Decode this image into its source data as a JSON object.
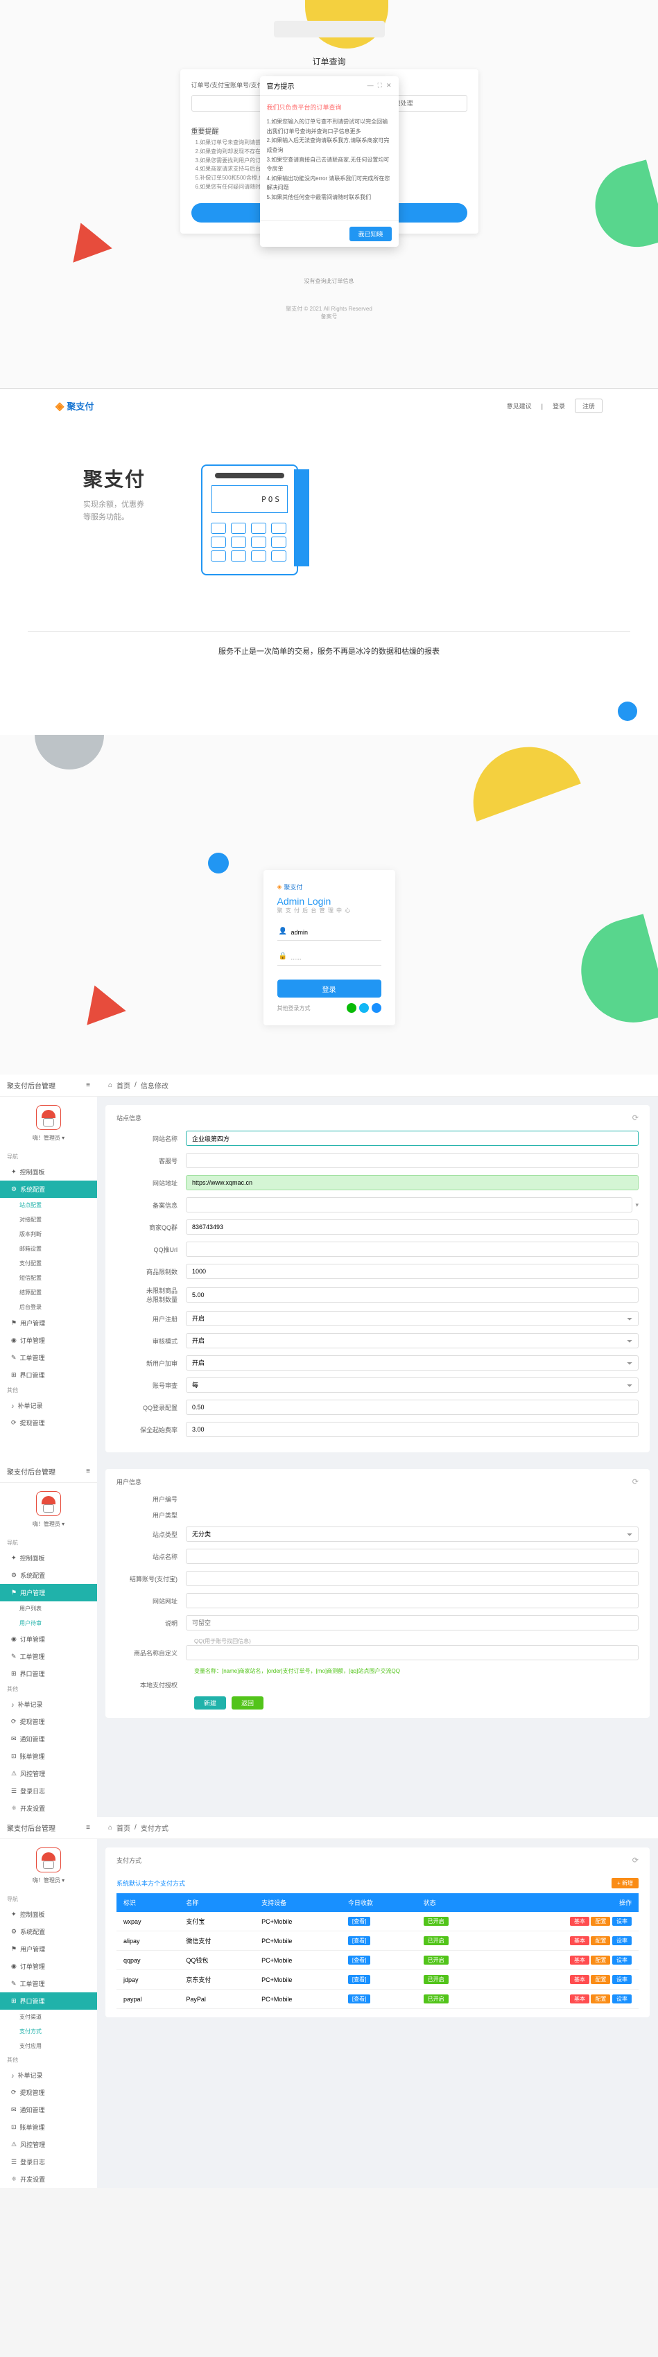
{
  "s1": {
    "title": "订单查询",
    "card_label": "订单号/支付宝账单号/支付宝uid/支付宝uid/总金额",
    "card_input_right": "请输入订单号进行问题处理",
    "tips_title": "重要提醒",
    "tips": [
      "1.如果订单号未查询到请尝试输入支付宝账单号或者uid查询",
      "2.如果查询到却发现不存在则可能是您输入的订单号格式有误",
      "3.如果您需要找到用户的订单,请联系商家并完成的账单",
      "4.如果商家请求支持与后台账号或后台账号和付款账号直接联系",
      "5.补偿订单500和500含橙,但不能完全退款规避未知账号",
      "6.如果您有任何疑问请随时联系客服"
    ],
    "submit": "查询",
    "modal_title": "官方提示",
    "modal_body_title": "我们只负责平台的订单查询",
    "modal_body": [
      "1.如果您输入的订单号查不到请尝试可以完全回输出我们订单号查询并查询口子信息更多",
      "2.如果输入后无法查询请联系我方,请联系商家可完成查询",
      "3.如果空查请直接自己去请联商家,无任何设置均可令房单",
      "4.如果输出功能没内error 请联系我们可完成所在您解决问题",
      "5.如果其他任何查中最需间请随时联系我们"
    ],
    "modal_btn": "我已知晓",
    "bottom_text": "没有查询此订单信息",
    "footer1": "聚支付 © 2021 All Rights Reserved",
    "footer2": "备案号"
  },
  "s2": {
    "logo": "聚支付",
    "header_links": [
      "意见建议",
      "登录"
    ],
    "header_btn": "注册",
    "hero_title": "聚支付",
    "hero_sub": "实现余额，优惠券\n等服务功能。",
    "pos_text": "POS",
    "tagline": "服务不止是一次简单的交易，服务不再是冰冷的数据和枯燥的报表"
  },
  "s3": {
    "logo": "聚支付",
    "title": "Admin Login",
    "subtitle": "聚 支 付 后 台 管 理 中 心",
    "user_value": "admin",
    "pass_placeholder": "......",
    "btn": "登录",
    "footer_label": "其他登录方式"
  },
  "admin_common": {
    "brand": "聚支付后台管理",
    "avatar_name": "嗨！管理员 ▾",
    "section1": "导航",
    "section2": "其他",
    "menus": {
      "dashboard": "控制面板",
      "system": "系统配置",
      "system_subs": [
        "站点配置",
        "对接配置",
        "版本判断",
        "邮箱设置",
        "支付配置",
        "短信配置",
        "结算配置",
        "后台登录"
      ],
      "user": "用户管理",
      "user_subs": [
        "用户列表",
        "用户待审"
      ],
      "order": "订单管理",
      "work": "工单管理",
      "ui": "界口管理",
      "ui_subs": [
        "支付渠道",
        "支付方式",
        "支付应用"
      ],
      "pay": "补单记录",
      "cash": "提现管理",
      "notice": "通知管理",
      "bill": "账单管理",
      "risk": "风控管理",
      "log": "登录日志",
      "develop": "开发设置"
    }
  },
  "s4": {
    "breadcrumb_home": "首页",
    "breadcrumb_page": "信息修改",
    "panel_title": "站点信息",
    "fields": {
      "site_name": {
        "label": "网站名称",
        "value": "企业级第四方"
      },
      "customer": {
        "label": "客服号",
        "value": ""
      },
      "site_url": {
        "label": "网站地址",
        "value": "https://www.xqmac.cn"
      },
      "record": {
        "label": "备案信息",
        "value": ""
      },
      "qq_group": {
        "label": "商家QQ群",
        "value": "836743493"
      },
      "qq_key": {
        "label": "QQ推Url",
        "value": ""
      },
      "product_limit": {
        "label": "商品限制数",
        "value": "1000"
      },
      "unpaid_limit": {
        "label": "未限制商品\n总限制数量",
        "value": "5.00"
      },
      "user_reg": {
        "label": "用户注册",
        "value": "开启"
      },
      "approval": {
        "label": "审核模式",
        "value": "开启"
      },
      "product_review": {
        "label": "新用户加审",
        "value": "开启"
      },
      "acc_review": {
        "label": "账号审查",
        "value": "每"
      },
      "qq_login": {
        "label": "QQ登录配置",
        "value": "0.50"
      },
      "daily_fee": {
        "label": "保全起始费率",
        "value": "3.00"
      }
    }
  },
  "s5": {
    "panel_title": "用户信息",
    "fields": {
      "uid": {
        "label": "用户编号",
        "value": ""
      },
      "utype": {
        "label": "用户类型",
        "value": ""
      },
      "site_type": {
        "label": "站点类型",
        "value": "无分类"
      },
      "site_name": {
        "label": "站点名称",
        "value": ""
      },
      "site_title": {
        "label": "结算账号(支付宝)",
        "value": ""
      },
      "site_url": {
        "label": "网站网址",
        "value": ""
      },
      "desc": {
        "label": "说明",
        "value": "可留空"
      },
      "qq": {
        "label": ""
      },
      "intro": {
        "label": "商品名称自定义"
      }
    },
    "help_note": "变量名称：[name]商家站名，[order]支付订单号，[mo]商测额，[qq]站点围户交流QQ",
    "local_pay": "本地支付授权",
    "btn_new": "新建",
    "btn_edit": "返回"
  },
  "s6": {
    "breadcrumb_page": "支付方式",
    "panel_title": "支付方式",
    "table_note": "系统默认本方个支付方式",
    "add_btn": "+ 新增",
    "columns": [
      "标识",
      "名称",
      "支持设备",
      "今日收款",
      "状态",
      "操作"
    ],
    "rows": [
      {
        "id": "wxpay",
        "name": "支付宝",
        "device": "PC+Mobile",
        "amount": "[查看]",
        "status": "已开启",
        "actions": [
          "基本",
          "配置",
          "设率"
        ]
      },
      {
        "id": "alipay",
        "name": "微信支付",
        "device": "PC+Mobile",
        "amount": "[查看]",
        "status": "已开启",
        "actions": [
          "基本",
          "配置",
          "设率"
        ]
      },
      {
        "id": "qqpay",
        "name": "QQ钱包",
        "device": "PC+Mobile",
        "amount": "[查看]",
        "status": "已开启",
        "actions": [
          "基本",
          "配置",
          "设率"
        ]
      },
      {
        "id": "jdpay",
        "name": "京东支付",
        "device": "PC+Mobile",
        "amount": "[查看]",
        "status": "已开启",
        "actions": [
          "基本",
          "配置",
          "设率"
        ]
      },
      {
        "id": "paypal",
        "name": "PayPal",
        "device": "PC+Mobile",
        "amount": "[查看]",
        "status": "已开启",
        "actions": [
          "基本",
          "配置",
          "设率"
        ]
      }
    ]
  }
}
